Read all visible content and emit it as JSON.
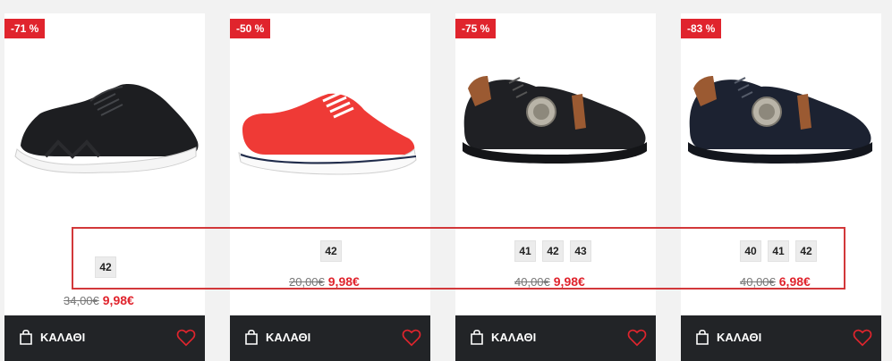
{
  "colors": {
    "accent": "#e0242d",
    "bar": "#222427",
    "highlight": "#d2383a"
  },
  "products": [
    {
      "badge": "-71 %",
      "sizes": [
        "42"
      ],
      "old_price": "34,00€",
      "new_price": "9,98€",
      "cart_label": "ΚΑΛΑΘΙ",
      "image": "black-knit-sneaker"
    },
    {
      "badge": "-50 %",
      "sizes": [
        "42"
      ],
      "old_price": "20,00€",
      "new_price": "9,98€",
      "cart_label": "ΚΑΛΑΘΙ",
      "image": "red-canvas-sneaker"
    },
    {
      "badge": "-75 %",
      "sizes": [
        "41",
        "42",
        "43"
      ],
      "old_price": "40,00€",
      "new_price": "9,98€",
      "cart_label": "ΚΑΛΑΘΙ",
      "image": "black-leather-sneaker"
    },
    {
      "badge": "-83 %",
      "sizes": [
        "40",
        "41",
        "42"
      ],
      "old_price": "40,00€",
      "new_price": "6,98€",
      "cart_label": "ΚΑΛΑΘΙ",
      "image": "navy-leather-sneaker"
    }
  ]
}
